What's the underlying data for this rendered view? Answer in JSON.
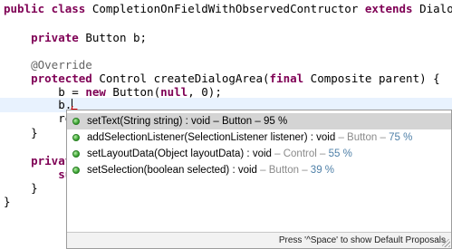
{
  "code": {
    "l1_a": "public class ",
    "l1_b": "CompletionOnFieldWithObservedContructor ",
    "l1_c": "extends",
    "l1_d": " Dialog {",
    "l2_a": "    private",
    "l2_b": " Button b;",
    "l3": "    @Override",
    "l4_a": "    protected",
    "l4_b": " Control createDialogArea(",
    "l4_c": "final",
    "l4_d": " Composite parent) {",
    "l5_a": "        b = ",
    "l5_b": "new",
    "l5_c": " Button(",
    "l5_d": "null",
    "l5_e": ", 0);",
    "l6": "        b.",
    "l7": "        re",
    "l8": "    }",
    "l9": "    privat",
    "l10": "        su",
    "l11": "    }",
    "l12": "}"
  },
  "completion": {
    "items": [
      {
        "sig": "setText(String string) : void",
        "owner": "Button",
        "pct": "95 %"
      },
      {
        "sig": "addSelectionListener(SelectionListener listener) : void",
        "owner": "Button",
        "pct": "75 %"
      },
      {
        "sig": "setLayoutData(Object layoutData) : void",
        "owner": "Control",
        "pct": "55 %"
      },
      {
        "sig": "setSelection(boolean selected) : void",
        "owner": "Button",
        "pct": "39 %"
      }
    ],
    "dash": " – ",
    "status": "Press '^Space' to show Default Proposals"
  },
  "colors": {
    "keyword": "#7f0055",
    "annotation": "#646464",
    "selection": "#d4d4d4",
    "percent": "#4f80a8",
    "method_icon": "#2f9a27"
  },
  "icons": [
    "method-public-icon",
    "resize-grip-icon"
  ]
}
